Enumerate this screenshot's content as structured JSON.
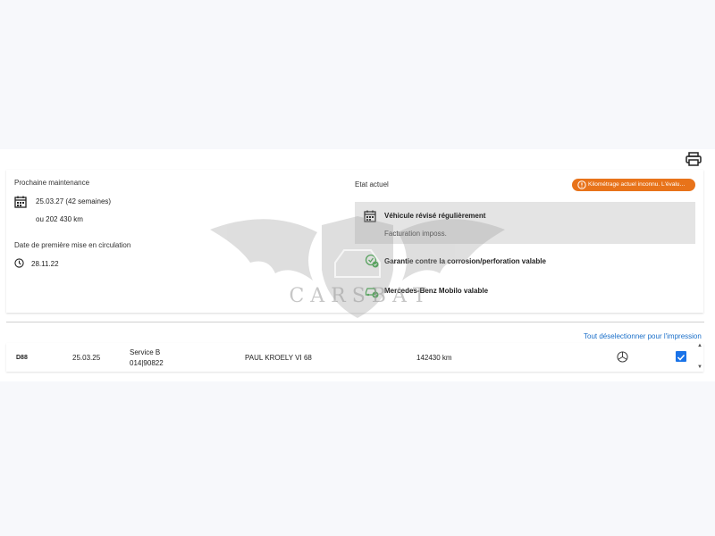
{
  "maintenance": {
    "heading": "Prochaine maintenance",
    "date": "25.03.27 (42 semaines)",
    "distance": "ou 202 430 km",
    "first_reg_heading": "Date de première mise en circulation",
    "first_reg_date": "28.11.22"
  },
  "status": {
    "heading": "Etat actuel",
    "badge_text": "Kilométrage actuel inconnu. L'évalu…",
    "badge_color": "#e8731a",
    "service_title": "Véhicule révisé régulièrement",
    "service_sub": "Facturation imposs.",
    "warranty": "Garantie contre la corrosion/perforation valable",
    "mobilo": "Mercedes-Benz Mobilo valable"
  },
  "watermark_text": "C A R S B A T",
  "list": {
    "deselect_link": "Tout déselectionner pour l'impression",
    "rows": [
      {
        "code": "D88",
        "date": "25.03.25",
        "service": "Service B",
        "ref": "014|90822",
        "workshop": "PAUL KROELY VI 68",
        "mileage": "142430 km",
        "checked": true
      }
    ]
  },
  "colors": {
    "accent": "#1a73e8",
    "link": "#1a6fc9",
    "ok_green": "#3aa845"
  },
  "icons": [
    "print-icon",
    "calendar-icon",
    "clock-icon",
    "warning-icon",
    "shield-check-icon",
    "car-check-icon",
    "mercedes-star-icon",
    "check-icon"
  ]
}
